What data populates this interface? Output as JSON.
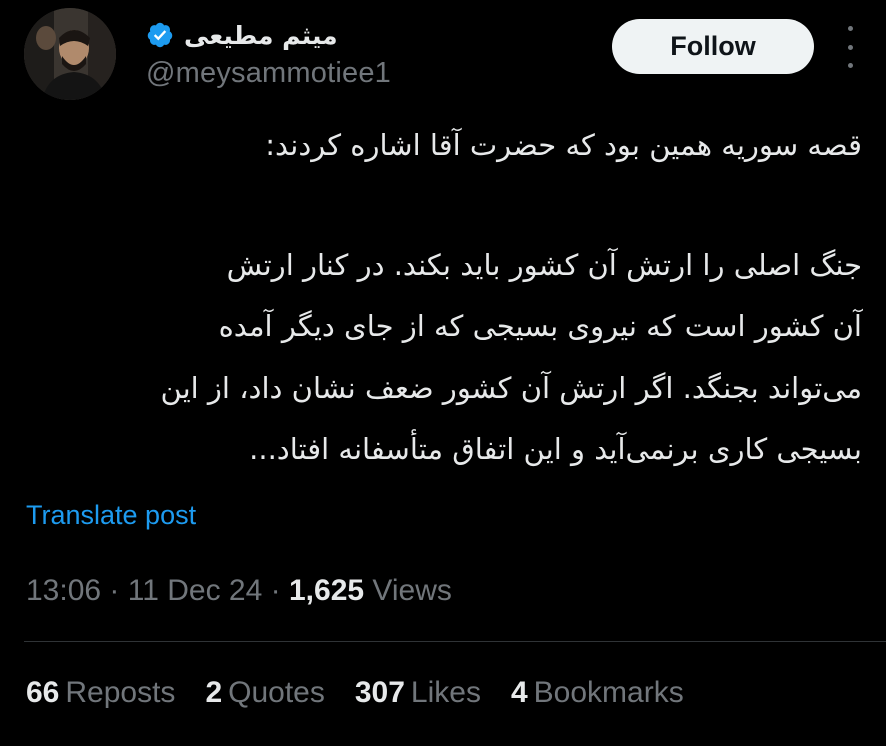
{
  "header": {
    "display_name": "میثم مطیعی",
    "handle": "@meysammotiee1",
    "follow_label": "Follow",
    "avatar_icon": "profile-photo",
    "verified_icon": "verified-badge",
    "more_icon": "more-vertical-icon"
  },
  "tweet": {
    "lines": [
      "قصه سوریه همین بود که حضرت آقا اشاره کردند:",
      "جنگ اصلی را ارتش آن کشور باید بکند. در کنار ارتش",
      "آن کشور است که نیروی بسیجی که از جای دیگر آمده",
      "می‌تواند بجنگد. اگر ارتش آن کشور ضعف نشان داد، از این",
      "بسیجی کاری برنمی‌آید و این اتفاق متأسفانه افتاد..."
    ],
    "translate_label": "Translate post"
  },
  "meta": {
    "time": "13:06",
    "separator": "·",
    "date": "11 Dec 24",
    "views_count": "1,625",
    "views_label": "Views"
  },
  "stats": {
    "reposts_count": "66",
    "reposts_label": "Reposts",
    "quotes_count": "2",
    "quotes_label": "Quotes",
    "likes_count": "307",
    "likes_label": "Likes",
    "bookmarks_count": "4",
    "bookmarks_label": "Bookmarks"
  },
  "colors": {
    "background": "#000000",
    "text": "#e7e9ea",
    "secondary": "#71767b",
    "link": "#1d9bf0",
    "follow_bg": "#eff3f4",
    "verified": "#1d9bf0"
  }
}
